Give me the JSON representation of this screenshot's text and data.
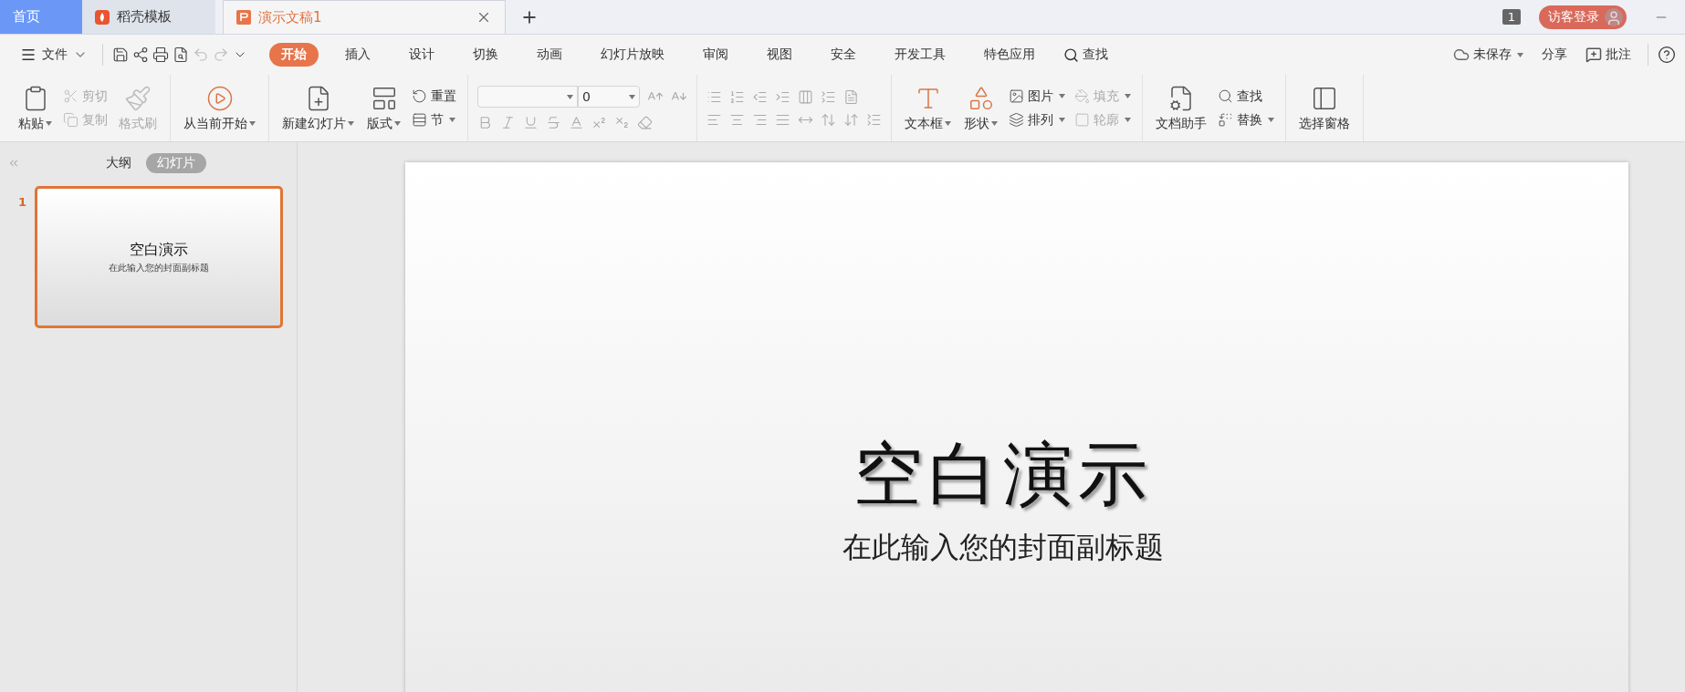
{
  "tabs": [
    {
      "kind": "home",
      "label": "首页",
      "selected": false
    },
    {
      "kind": "template",
      "label": "稻壳模板",
      "selected": false
    },
    {
      "kind": "document",
      "label": "演示文稿1",
      "selected": true
    }
  ],
  "window_count": "1",
  "login": "访客登录",
  "file_menu": "文件",
  "ribbon_tabs": [
    {
      "label": "开始",
      "selected": true
    },
    {
      "label": "插入",
      "selected": false
    },
    {
      "label": "设计",
      "selected": false
    },
    {
      "label": "切换",
      "selected": false
    },
    {
      "label": "动画",
      "selected": false
    },
    {
      "label": "幻灯片放映",
      "selected": false
    },
    {
      "label": "审阅",
      "selected": false
    },
    {
      "label": "视图",
      "selected": false
    },
    {
      "label": "安全",
      "selected": false
    },
    {
      "label": "开发工具",
      "selected": false
    },
    {
      "label": "特色应用",
      "selected": false
    }
  ],
  "search": "查找",
  "right_actions": [
    {
      "label": "未保存",
      "dropdown": true
    },
    {
      "label": "分享",
      "dropdown": false
    },
    {
      "label": "批注",
      "dropdown": false
    }
  ],
  "font_size": "0",
  "ribbon_groups": [
    {
      "items": [
        {
          "kind": "large",
          "label": "粘贴",
          "dropdown": true,
          "disabled": false
        },
        {
          "kind": "stack",
          "children": [
            {
              "label": "剪切",
              "dropdown": false,
              "disabled": true
            },
            {
              "label": "复制",
              "dropdown": false,
              "disabled": true
            }
          ]
        },
        {
          "kind": "large",
          "label": "格式刷",
          "dropdown": false,
          "disabled": true
        }
      ]
    },
    {
      "items": [
        {
          "kind": "large",
          "label": "从当前开始",
          "dropdown": true,
          "disabled": false
        }
      ]
    },
    {
      "items": [
        {
          "kind": "large",
          "label": "新建幻灯片",
          "dropdown": true,
          "disabled": false
        },
        {
          "kind": "large",
          "label": "版式",
          "dropdown": true,
          "disabled": false
        },
        {
          "kind": "stack",
          "children": [
            {
              "label": "重置",
              "dropdown": false,
              "disabled": false
            },
            {
              "label": "节",
              "dropdown": true,
              "disabled": false
            }
          ]
        }
      ]
    },
    {
      "items": [
        {
          "kind": "font"
        }
      ]
    },
    {
      "items": [
        {
          "kind": "paragraph"
        }
      ]
    },
    {
      "items": [
        {
          "kind": "large",
          "label": "文本框",
          "dropdown": true,
          "disabled": false
        },
        {
          "kind": "large",
          "label": "形状",
          "dropdown": true,
          "disabled": false
        },
        {
          "kind": "stack",
          "children": [
            {
              "label": "图片",
              "dropdown": true,
              "disabled": false
            },
            {
              "label": "排列",
              "dropdown": true,
              "disabled": false
            }
          ]
        },
        {
          "kind": "stack",
          "children": [
            {
              "label": "填充",
              "dropdown": true,
              "disabled": true
            },
            {
              "label": "轮廓",
              "dropdown": true,
              "disabled": true
            }
          ]
        }
      ]
    },
    {
      "items": [
        {
          "kind": "large",
          "label": "文档助手",
          "dropdown": false,
          "disabled": false
        },
        {
          "kind": "stack",
          "children": [
            {
              "label": "查找",
              "dropdown": false,
              "disabled": false
            },
            {
              "label": "替换",
              "dropdown": true,
              "disabled": false
            }
          ]
        }
      ]
    },
    {
      "items": [
        {
          "kind": "large",
          "label": "选择窗格",
          "dropdown": false,
          "disabled": false
        }
      ]
    }
  ],
  "view_tabs": [
    {
      "label": "大纲",
      "selected": false
    },
    {
      "label": "幻灯片",
      "selected": true
    }
  ],
  "slides": [
    {
      "number": "1",
      "title": "空白演示",
      "subtitle": "在此输入您的封面副标题",
      "selected": true
    }
  ],
  "slide": {
    "title": "空白演示",
    "subtitle": "在此输入您的封面副标题"
  }
}
